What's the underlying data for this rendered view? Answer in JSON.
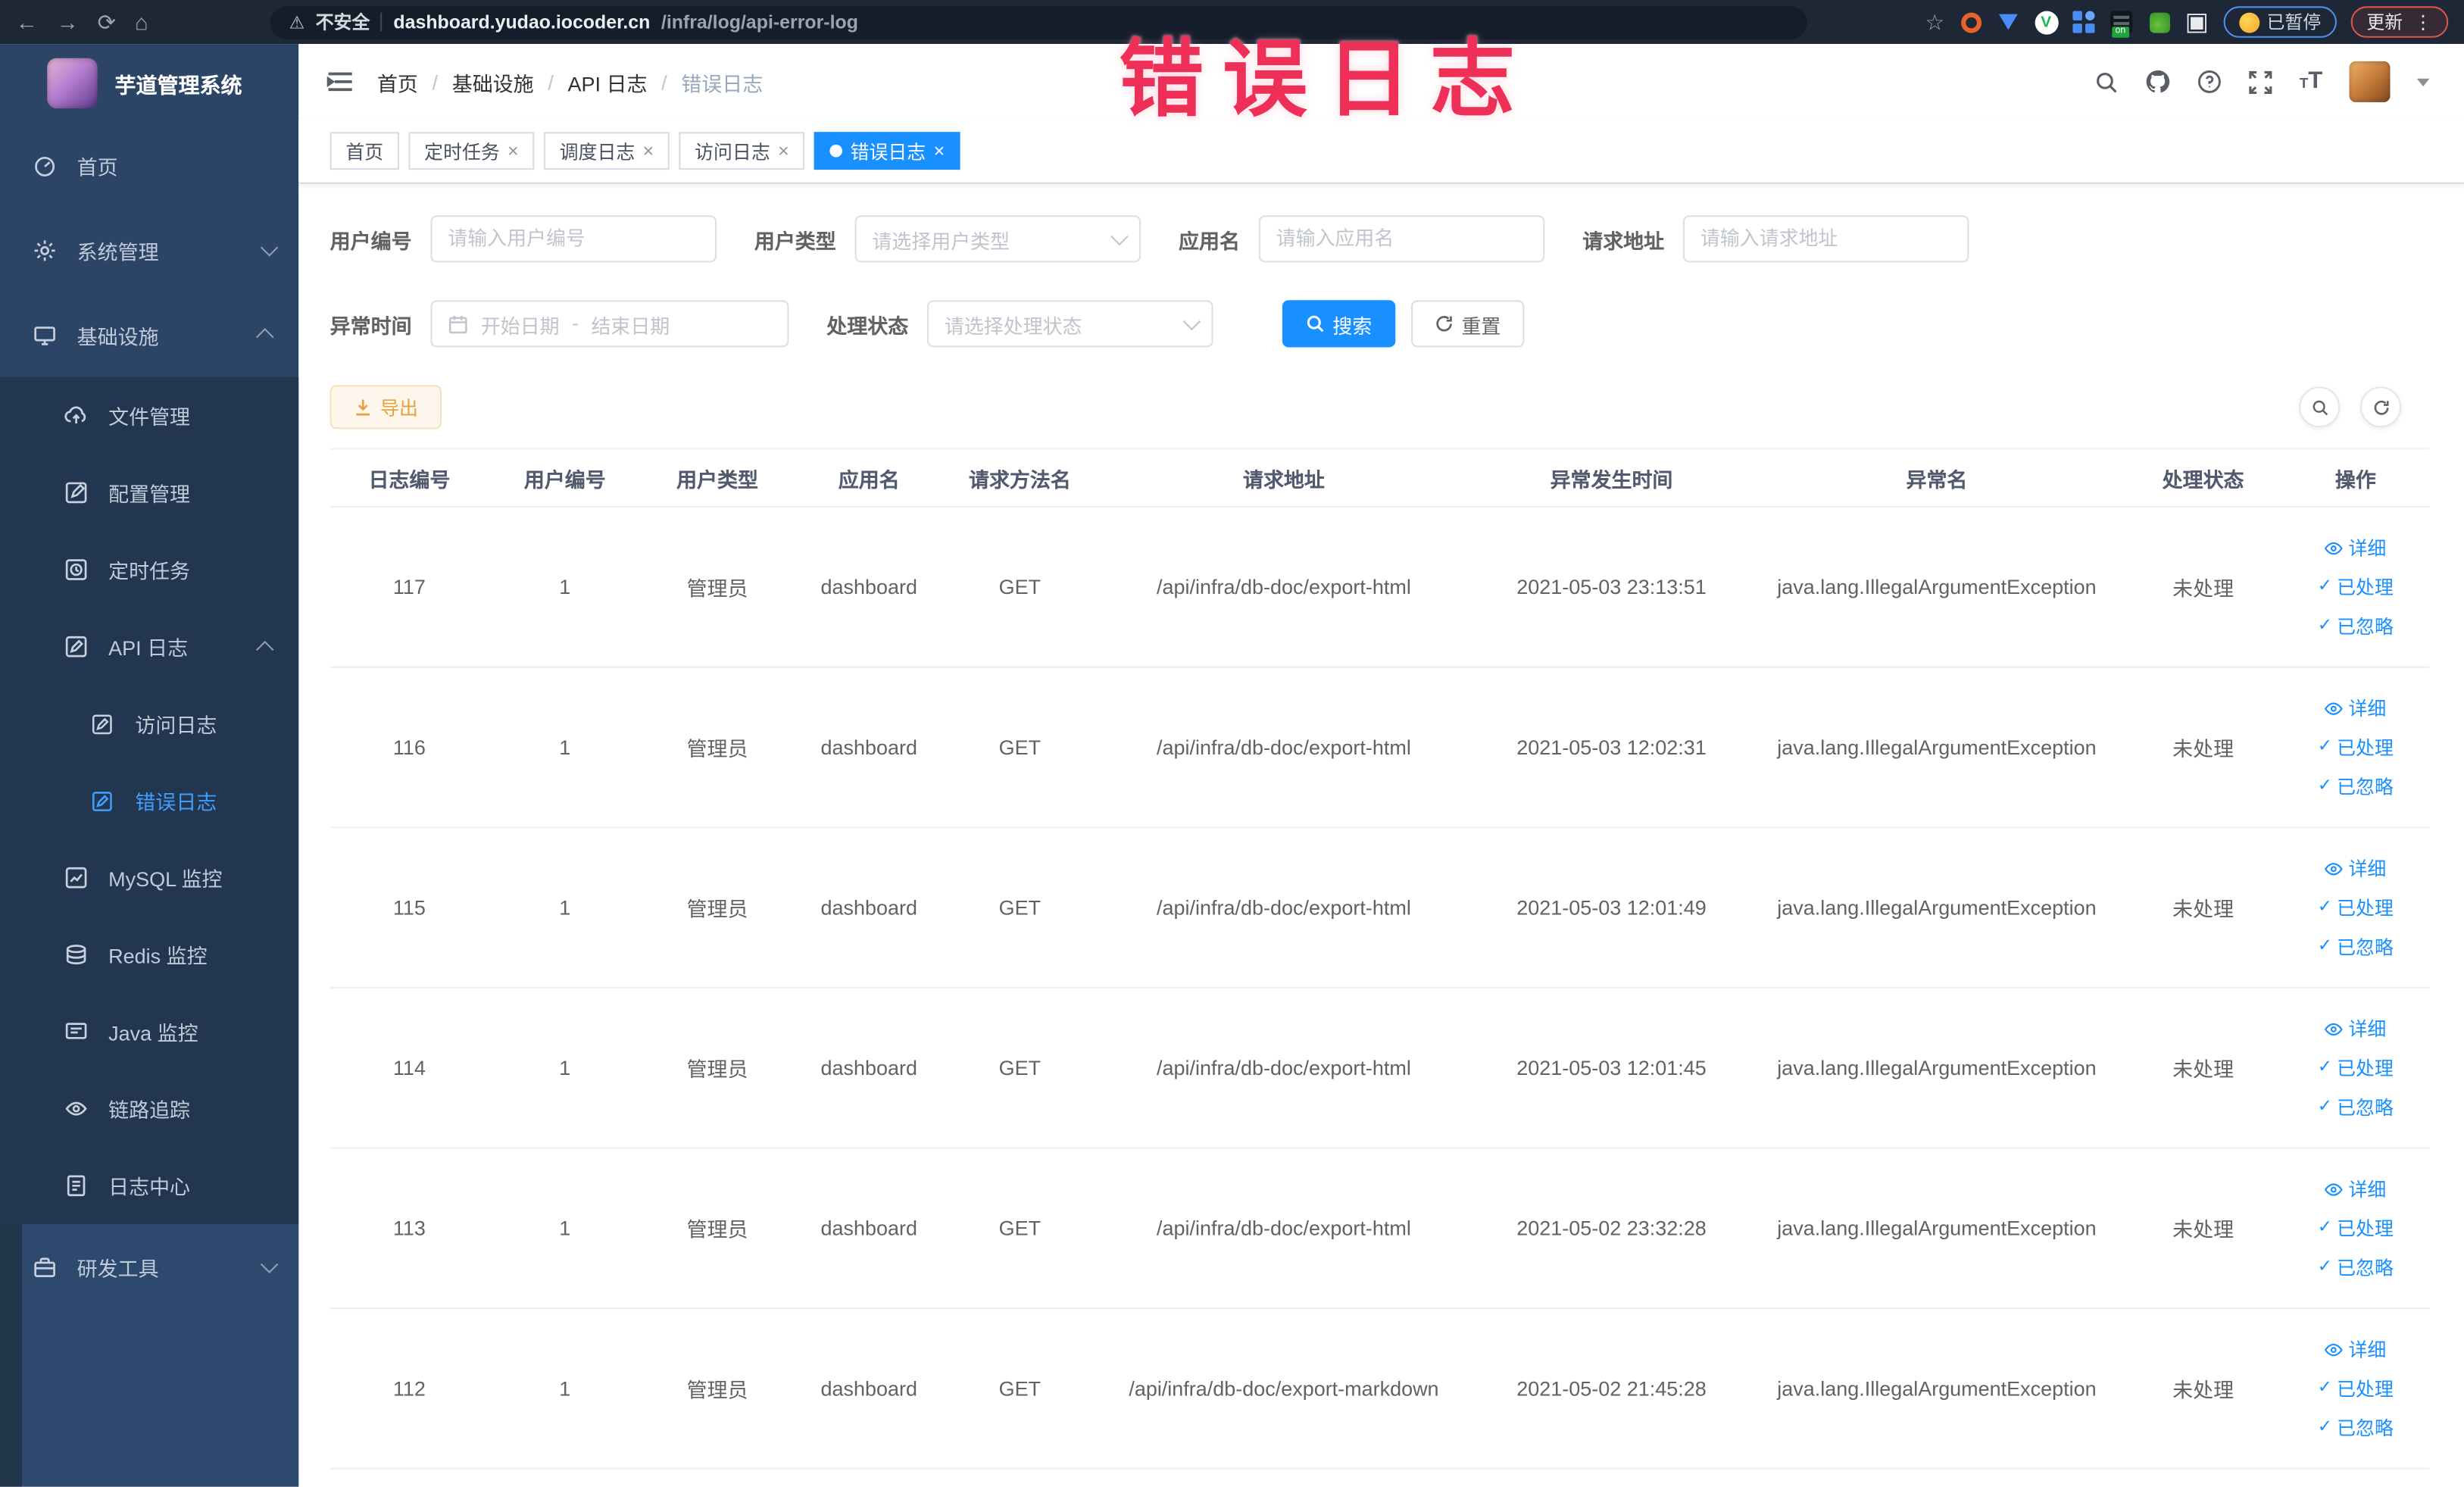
{
  "browser": {
    "security_label": "不安全",
    "url_domain": "dashboard.yudao.iocoder.cn",
    "url_path": "/infra/log/api-error-log",
    "paused_badge": "已暂停",
    "update_button": "更新"
  },
  "watermark": "错误日志",
  "icons": {
    "back": "←",
    "forward": "→",
    "reload": "⟳",
    "home": "⌂",
    "warning": "⚠",
    "star": "☆",
    "kebab": "⋮",
    "puzzle": "▣",
    "check": "✓",
    "close": "×"
  },
  "sidebar": {
    "title": "芋道管理系统",
    "items": [
      {
        "label": "首页"
      },
      {
        "label": "系统管理"
      },
      {
        "label": "基础设施"
      },
      {
        "label": "文件管理"
      },
      {
        "label": "配置管理"
      },
      {
        "label": "定时任务"
      },
      {
        "label": "API 日志"
      },
      {
        "label": "访问日志"
      },
      {
        "label": "错误日志"
      },
      {
        "label": "MySQL 监控"
      },
      {
        "label": "Redis 监控"
      },
      {
        "label": "Java 监控"
      },
      {
        "label": "链路追踪"
      },
      {
        "label": "日志中心"
      },
      {
        "label": "研发工具"
      }
    ]
  },
  "navbar": {
    "breadcrumb": {
      "home": "首页",
      "section": "基础设施",
      "group": "API 日志",
      "current": "错误日志",
      "separator": "/"
    }
  },
  "tabs": [
    {
      "label": "首页",
      "closable": false,
      "active": false
    },
    {
      "label": "定时任务",
      "closable": true,
      "active": false
    },
    {
      "label": "调度日志",
      "closable": true,
      "active": false
    },
    {
      "label": "访问日志",
      "closable": true,
      "active": false
    },
    {
      "label": "错误日志",
      "closable": true,
      "active": true
    }
  ],
  "filters": {
    "user_id": {
      "label": "用户编号",
      "placeholder": "请输入用户编号"
    },
    "user_type": {
      "label": "用户类型",
      "placeholder": "请选择用户类型"
    },
    "app_name": {
      "label": "应用名",
      "placeholder": "请输入应用名"
    },
    "request_url": {
      "label": "请求地址",
      "placeholder": "请输入请求地址"
    },
    "exception_time": {
      "label": "异常时间",
      "start_placeholder": "开始日期",
      "range_separator": "-",
      "end_placeholder": "结束日期"
    },
    "process_status": {
      "label": "处理状态",
      "placeholder": "请选择处理状态"
    },
    "search_button": "搜索",
    "reset_button": "重置"
  },
  "toolbar": {
    "export_button": "导出"
  },
  "table": {
    "columns": [
      "日志编号",
      "用户编号",
      "用户类型",
      "应用名",
      "请求方法名",
      "请求地址",
      "异常发生时间",
      "异常名",
      "处理状态",
      "操作"
    ],
    "row_actions": {
      "detail": "详细",
      "processed": "已处理",
      "ignored": "已忽略"
    },
    "rows": [
      {
        "id": "117",
        "user_id": "1",
        "user_type": "管理员",
        "app_name": "dashboard",
        "method": "GET",
        "url": "/api/infra/db-doc/export-html",
        "time": "2021-05-03 23:13:51",
        "exception": "java.lang.IllegalArgumentException",
        "status": "未处理"
      },
      {
        "id": "116",
        "user_id": "1",
        "user_type": "管理员",
        "app_name": "dashboard",
        "method": "GET",
        "url": "/api/infra/db-doc/export-html",
        "time": "2021-05-03 12:02:31",
        "exception": "java.lang.IllegalArgumentException",
        "status": "未处理"
      },
      {
        "id": "115",
        "user_id": "1",
        "user_type": "管理员",
        "app_name": "dashboard",
        "method": "GET",
        "url": "/api/infra/db-doc/export-html",
        "time": "2021-05-03 12:01:49",
        "exception": "java.lang.IllegalArgumentException",
        "status": "未处理"
      },
      {
        "id": "114",
        "user_id": "1",
        "user_type": "管理员",
        "app_name": "dashboard",
        "method": "GET",
        "url": "/api/infra/db-doc/export-html",
        "time": "2021-05-03 12:01:45",
        "exception": "java.lang.IllegalArgumentException",
        "status": "未处理"
      },
      {
        "id": "113",
        "user_id": "1",
        "user_type": "管理员",
        "app_name": "dashboard",
        "method": "GET",
        "url": "/api/infra/db-doc/export-html",
        "time": "2021-05-02 23:32:28",
        "exception": "java.lang.IllegalArgumentException",
        "status": "未处理"
      },
      {
        "id": "112",
        "user_id": "1",
        "user_type": "管理员",
        "app_name": "dashboard",
        "method": "GET",
        "url": "/api/infra/db-doc/export-markdown",
        "time": "2021-05-02 21:45:28",
        "exception": "java.lang.IllegalArgumentException",
        "status": "未处理"
      }
    ]
  },
  "colors": {
    "accent": "#1890ff",
    "active_menu": "#409eff",
    "watermark_red": "#ee2f58",
    "sidebar_bg": "#2c4566",
    "submenu_bg": "#22374f",
    "chrome_bg": "#1d2735",
    "warning_text": "#e6a23c",
    "tag_active_bg": "#1890ff"
  }
}
